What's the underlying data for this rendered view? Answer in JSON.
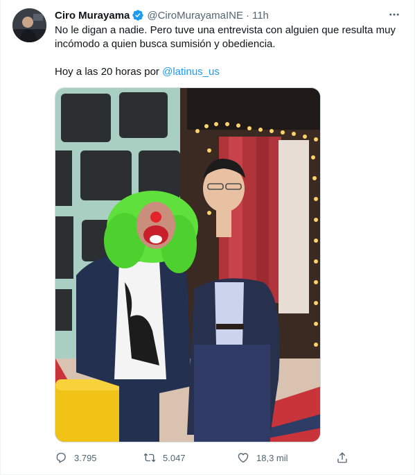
{
  "tweet": {
    "author_name": "Ciro Murayama",
    "verified": true,
    "handle": "@CiroMurayamaINE",
    "separator": "·",
    "time": "11h",
    "text_line1": "No le digan a nadie. Pero tuve una entrevista con alguien que resulta muy incómodo a quien busca sumisión y obediencia.",
    "text_line2_prefix": "Hoy a las 20 horas por ",
    "mention": "@latinus_us"
  },
  "actions": {
    "reply_count": "3.795",
    "retweet_count": "5.047",
    "like_count": "18,3 mil"
  },
  "colors": {
    "accent": "#1d9bf0",
    "secondary_text": "#536471",
    "primary_text": "#0f1419",
    "retweet_icon": "#00ba7c",
    "like_icon": "#f91880"
  },
  "icons": {
    "more": "more-horizontal-icon",
    "verified": "verified-badge-icon",
    "reply": "reply-icon",
    "retweet": "retweet-icon",
    "like": "heart-icon",
    "share": "share-icon"
  }
}
